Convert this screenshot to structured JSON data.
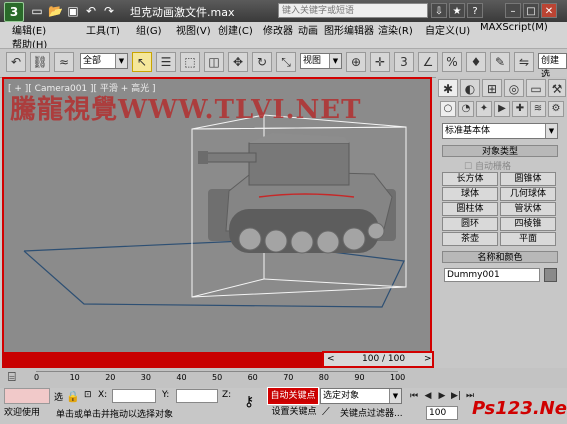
{
  "window": {
    "title": "坦克动画激文件.max",
    "search_placeholder": "键入关键字或短语",
    "controls": [
      "⇩",
      "★",
      "?",
      "–",
      "□",
      "✕"
    ]
  },
  "menu": {
    "row1": [
      "编辑(E)",
      "工具(T)",
      "组(G)",
      "视图(V)",
      "创建(C)",
      "修改器",
      "动画",
      "图形编辑器",
      "渲染(R)",
      "自定义(U)",
      "MAXScript(M)"
    ],
    "row2": [
      "帮助(H)"
    ]
  },
  "toolbar": {
    "selection_filter": "全部",
    "ref_coord": "视图",
    "named_selection": "创建选"
  },
  "viewport": {
    "label": "[ + ][ Camera001 ][ 平滑 + 高光 ]",
    "watermark": "騰龍視覺WWW.TLVI.NET"
  },
  "time_slider": {
    "frame": "100 / 100",
    "prev": "<",
    "next": ">"
  },
  "command_panel": {
    "category_dropdown": "标准基本体",
    "object_type_title": "对象类型",
    "autogrid_label": "自动栅格",
    "object_buttons": [
      "长方体",
      "圆锥体",
      "球体",
      "几何球体",
      "圆柱体",
      "管状体",
      "圆环",
      "四棱锥",
      "茶壶",
      "平面"
    ],
    "name_color_title": "名称和颜色",
    "object_name": "Dummy001",
    "object_color": "#8a8a8a"
  },
  "trackbar": {
    "ticks": [
      "0",
      "10",
      "20",
      "30",
      "40",
      "50",
      "60",
      "70",
      "80",
      "90",
      "100"
    ]
  },
  "status": {
    "welcome": "欢迎使用",
    "message": "单击或单击并拖动以选择对象",
    "selected_label": "选",
    "x_label": "X:",
    "y_label": "Y:",
    "z_label": "Z:",
    "auto_key": "自动关键点",
    "set_key": "设置关键点",
    "selected_object": "选定对象",
    "key_filters": "关键点过滤器...",
    "current_frame": "100",
    "site_watermark": "Ps123.Net"
  },
  "colors": {
    "highlight": "#d20000",
    "auto_key_bg": "#c80000",
    "viewport_bg": "#8b8b8b"
  }
}
